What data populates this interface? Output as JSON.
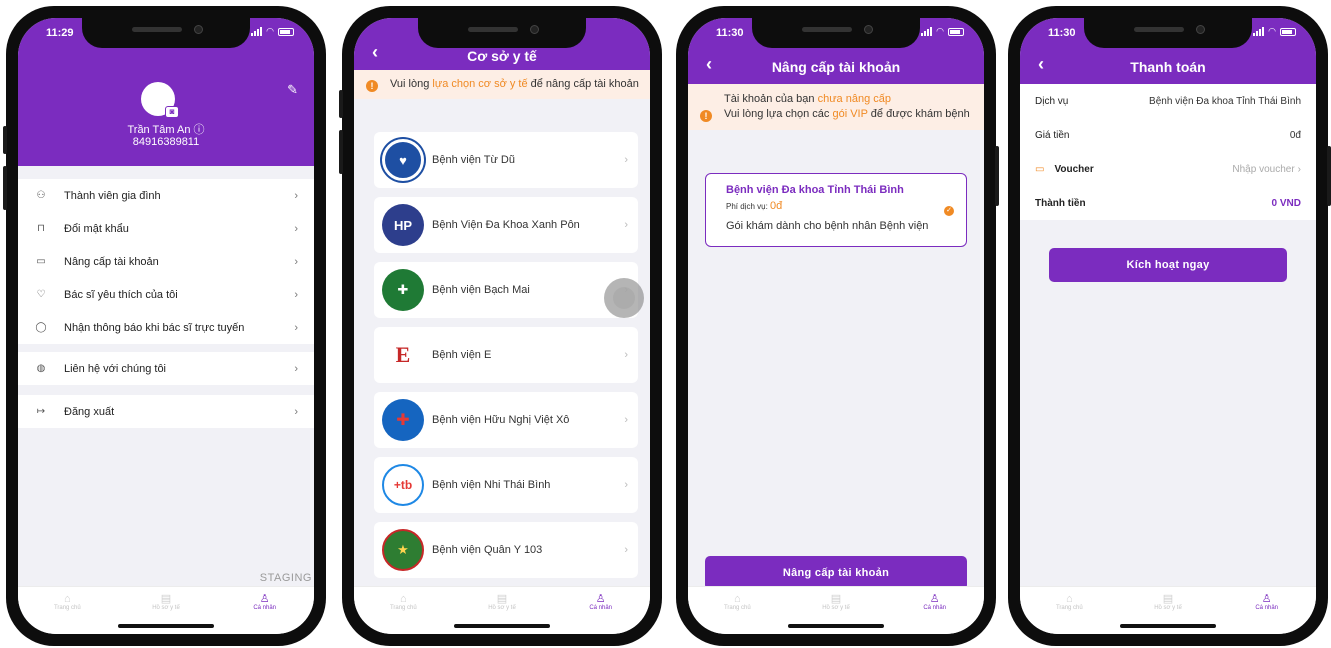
{
  "colors": {
    "primary": "#7b2cbf",
    "accent": "#f08a24",
    "background": "#f1f1f6"
  },
  "tabbar": {
    "home": "Trang chủ",
    "records": "Hồ sơ y tế",
    "profile": "Cá nhân"
  },
  "phone1": {
    "time": "11:29",
    "user_name": "Trần Tâm An",
    "user_phone": "84916389811",
    "menu": [
      {
        "icon": "family-icon",
        "label": "Thành viên gia đình"
      },
      {
        "icon": "lock-icon",
        "label": "Đổi mật khẩu"
      },
      {
        "icon": "upgrade-icon",
        "label": "Nâng cấp tài khoản"
      },
      {
        "icon": "heart-icon",
        "label": "Bác sĩ yêu thích của tôi"
      },
      {
        "icon": "bell-icon",
        "label": "Nhận thông báo khi bác sĩ trực tuyến"
      },
      {
        "icon": "globe-icon",
        "label": "Liên hệ với chúng tôi"
      },
      {
        "icon": "logout-icon",
        "label": "Đăng xuất"
      }
    ],
    "env_label": "STAGING"
  },
  "phone2": {
    "title": "Cơ sở y tế",
    "notice_pre": "Vui lòng ",
    "notice_hl": "lựa chọn cơ sở y tế",
    "notice_post": " để nâng cấp tài khoản",
    "hospitals": [
      {
        "name": "Bệnh viện Từ Dũ",
        "logo_color": "#1e4fa3"
      },
      {
        "name": "Bệnh Viện Đa Khoa Xanh Pôn",
        "logo_color": "#2d3e8c"
      },
      {
        "name": "Bệnh viện Bạch Mai",
        "logo_color": "#1f7a35"
      },
      {
        "name": "Bệnh viện E",
        "logo_color": "#c62828"
      },
      {
        "name": "Bệnh viện Hữu Nghị Việt Xô",
        "logo_color": "#1565c0"
      },
      {
        "name": "Bệnh viện Nhi Thái Bình",
        "logo_color": "#1e88e5"
      },
      {
        "name": "Bệnh viện Quân Y 103",
        "logo_color": "#2e7d32"
      }
    ]
  },
  "phone3": {
    "time": "11:30",
    "title": "Nâng cấp tài khoản",
    "notice_l1_pre": "Tài khoản của bạn ",
    "notice_l1_hl": "chưa nâng cấp",
    "notice_l2_pre": "Vui lòng lựa chọn các ",
    "notice_l2_hl": "gói VIP",
    "notice_l2_post": " để được khám bệnh",
    "card_name": "Bệnh viện Đa khoa Tỉnh Thái Bình",
    "fee_label": "Phí dịch vụ: ",
    "fee_value": "0đ",
    "card_desc": "Gói khám dành cho bệnh nhân Bệnh viện",
    "button": "Nâng cấp tài khoản"
  },
  "phone4": {
    "time": "11:30",
    "title": "Thanh toán",
    "service_label": "Dịch vụ",
    "service_value": "Bệnh viện Đa khoa Tỉnh Thái Bình",
    "price_label": "Giá tiền",
    "price_value": "0đ",
    "voucher_label": "Voucher",
    "voucher_placeholder": "Nhập voucher",
    "total_label": "Thành tiền",
    "total_value": "0 VND",
    "button": "Kích hoạt ngay"
  }
}
